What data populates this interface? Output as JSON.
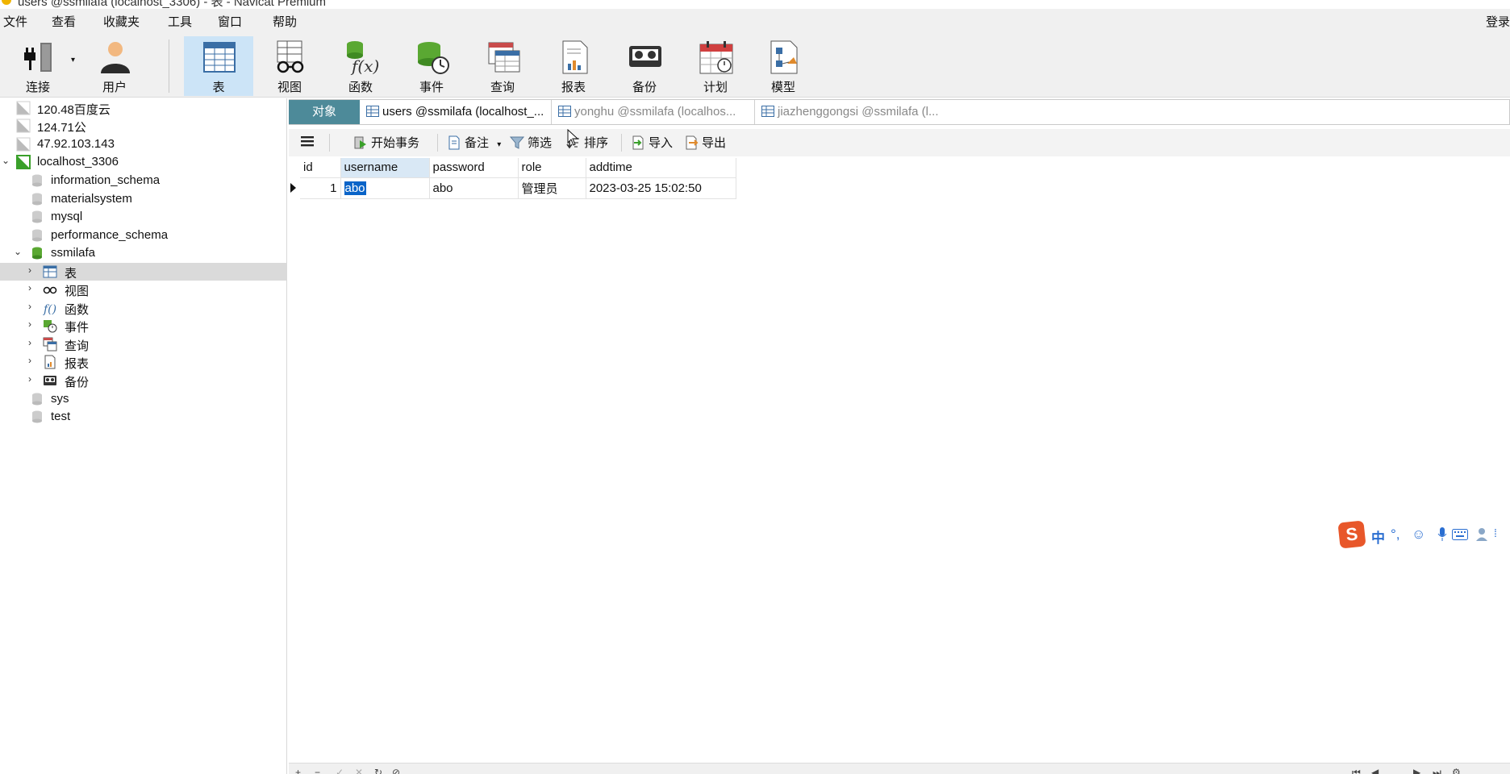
{
  "window": {
    "title": "users @ssmilafa (localhost_3306) - 表 - Navicat Premium"
  },
  "menu": {
    "items": [
      "文件",
      "查看",
      "收藏夹",
      "工具",
      "窗口",
      "帮助"
    ],
    "login": "登录"
  },
  "toolbar": {
    "buttons": [
      {
        "label": "连接",
        "icon": "plug-icon"
      },
      {
        "label": "用户",
        "icon": "user-icon"
      },
      {
        "label": "表",
        "icon": "table-icon"
      },
      {
        "label": "视图",
        "icon": "view-icon"
      },
      {
        "label": "函数",
        "icon": "function-icon"
      },
      {
        "label": "事件",
        "icon": "event-icon"
      },
      {
        "label": "查询",
        "icon": "query-icon"
      },
      {
        "label": "报表",
        "icon": "report-icon"
      },
      {
        "label": "备份",
        "icon": "backup-icon"
      },
      {
        "label": "计划",
        "icon": "schedule-icon"
      },
      {
        "label": "模型",
        "icon": "model-icon"
      }
    ]
  },
  "navigator": {
    "items": [
      {
        "label": "120.48百度云"
      },
      {
        "label": "124.71公"
      },
      {
        "label": "47.92.103.143"
      },
      {
        "label": "localhost_3306"
      },
      {
        "label": "information_schema"
      },
      {
        "label": "materialsystem"
      },
      {
        "label": "mysql"
      },
      {
        "label": "performance_schema"
      },
      {
        "label": "ssmilafa"
      },
      {
        "label": "表"
      },
      {
        "label": "视图"
      },
      {
        "label": "函数"
      },
      {
        "label": "事件"
      },
      {
        "label": "查询"
      },
      {
        "label": "报表"
      },
      {
        "label": "备份"
      },
      {
        "label": "sys"
      },
      {
        "label": "test"
      }
    ]
  },
  "tabs": {
    "objects": "对象",
    "items": [
      {
        "label": "users @ssmilafa (localhost_..."
      },
      {
        "label": "yonghu @ssmilafa (localhos..."
      },
      {
        "label": "jiazhenggongsi @ssmilafa (l..."
      }
    ]
  },
  "gridbar": {
    "begin_tx": "开始事务",
    "memo": "备注",
    "filter": "筛选",
    "sort": "排序",
    "import": "导入",
    "export": "导出"
  },
  "grid": {
    "columns": [
      "id",
      "username",
      "password",
      "role",
      "addtime"
    ],
    "rows": [
      {
        "id": "1",
        "username": "abo",
        "password": "abo",
        "role": "管理员",
        "addtime": "2023-03-25 15:02:50"
      }
    ]
  },
  "ime": {
    "mode": "中",
    "punct": "°,"
  },
  "colors": {
    "toolbar_bg": "#f0f0f0",
    "active_button": "#cce4f7",
    "objects_tab": "#4d8a99",
    "cell_selection": "#0a64c8",
    "nav_selected": "#dadada"
  }
}
